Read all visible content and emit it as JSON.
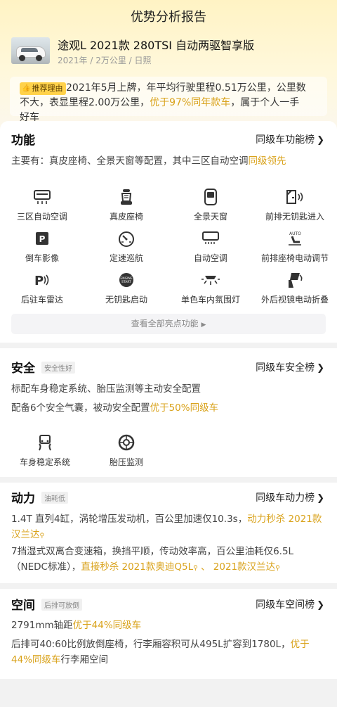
{
  "header": {
    "title": "优势分析报告"
  },
  "car": {
    "name": "途观L 2021款 280TSI 自动两驱智享版",
    "sub": "2021年 / 2万公里 / 日照"
  },
  "reason": {
    "tag": "推荐理由",
    "text_1": "2021年5月上牌，年平均行驶里程0.51万公里，公里数不大，表显里程2.00万公里，",
    "text_hl": "优于97%同年款车",
    "text_2": "，属于个人一手好车"
  },
  "function": {
    "title": "功能",
    "link": "同级车功能榜",
    "summary_1": "主要有：真皮座椅、全景天窗等配置，其中三区自动空调",
    "summary_hl": "同级领先",
    "items": [
      {
        "label": "三区自动空调",
        "icon": "ac-panel-icon"
      },
      {
        "label": "真皮座椅",
        "icon": "leather-seat-icon"
      },
      {
        "label": "全景天窗",
        "icon": "sunroof-icon"
      },
      {
        "label": "前排无钥匙进入",
        "icon": "keyless-entry-icon"
      },
      {
        "label": "倒车影像",
        "icon": "reverse-camera-icon"
      },
      {
        "label": "定速巡航",
        "icon": "cruise-control-icon"
      },
      {
        "label": "自动空调",
        "icon": "auto-ac-icon"
      },
      {
        "label": "前排座椅电动调节",
        "icon": "power-seat-icon"
      },
      {
        "label": "后驻车雷达",
        "icon": "parking-radar-icon"
      },
      {
        "label": "无钥匙启动",
        "icon": "keyless-start-icon"
      },
      {
        "label": "单色车内氛围灯",
        "icon": "ambient-light-icon"
      },
      {
        "label": "外后视镜电动折叠",
        "icon": "mirror-fold-icon"
      }
    ],
    "view_all": "查看全部亮点功能"
  },
  "safety": {
    "title": "安全",
    "badge": "安全性好",
    "link": "同级车安全榜",
    "line1": "标配车身稳定系统、胎压监测等主动安全配置",
    "line2_1": "配备6个安全气囊，被动安全配置",
    "line2_hl": "优于50%同级车",
    "items": [
      {
        "label": "车身稳定系统",
        "icon": "esp-icon"
      },
      {
        "label": "胎压监测",
        "icon": "tire-pressure-icon"
      }
    ]
  },
  "power": {
    "title": "动力",
    "badge": "油耗低",
    "link": "同级车动力榜",
    "line1_1": "1.4T 直列4缸，涡轮增压发动机，百公里加速仅10.3s，",
    "line1_hl": "动力秒杀 2021款汉兰达",
    "line2_1": "7挡湿式双离合变速箱，换挡平顺，传动效率高，百公里油耗仅6.5L（NEDC标准），",
    "line2_hl1": "直接秒杀 2021款奥迪Q5L",
    "line2_sep": " 、 ",
    "line2_hl2": "2021款汉兰达"
  },
  "space": {
    "title": "空间",
    "badge": "后排可放倒",
    "link": "同级车空间榜",
    "line1_1": "2791mm轴距",
    "line1_hl": "优于44%同级车",
    "line2_1": "后排可40:60比例放倒座椅，行李厢容积可从495L扩容到1780L，",
    "line2_hl": "优于44%同级车",
    "line2_2": "行李厢空间"
  },
  "colors": {
    "accent": "#d9a21a",
    "tag": "#ffd24a",
    "hero": "#fff3c4"
  }
}
